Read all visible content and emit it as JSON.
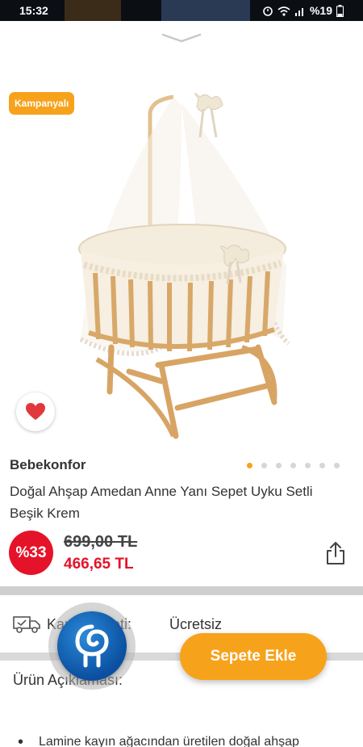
{
  "status_bar": {
    "time": "15:32",
    "battery": "%19"
  },
  "badge": "Kampanyalı",
  "product": {
    "brand": "Bebekonfor",
    "title": "Doğal Ahşap Amedan Anne Yanı Sepet Uyku Setli Beşik Krem",
    "discount": "%33",
    "old_price": "699,00 TL",
    "new_price": "466,65 TL",
    "image_count": 7,
    "active_image": 1
  },
  "shipping": {
    "label": "Kargo Ücreti:",
    "value": "Ücretsiz"
  },
  "description": {
    "heading": "Ürün Açıklaması:",
    "items": [
      "Lamine kayın ağacından üretilen doğal ahşap"
    ]
  },
  "cart_button": "Sepete Ekle",
  "colors": {
    "accent": "#f7a21b",
    "discount": "#e5132a",
    "assistant": "#0b4fa0"
  },
  "icons": [
    "chevron-down-icon",
    "heart-icon",
    "share-icon",
    "truck-icon",
    "assistant-icon",
    "wifi-icon",
    "signal-icon",
    "battery-icon",
    "alarm-icon"
  ]
}
